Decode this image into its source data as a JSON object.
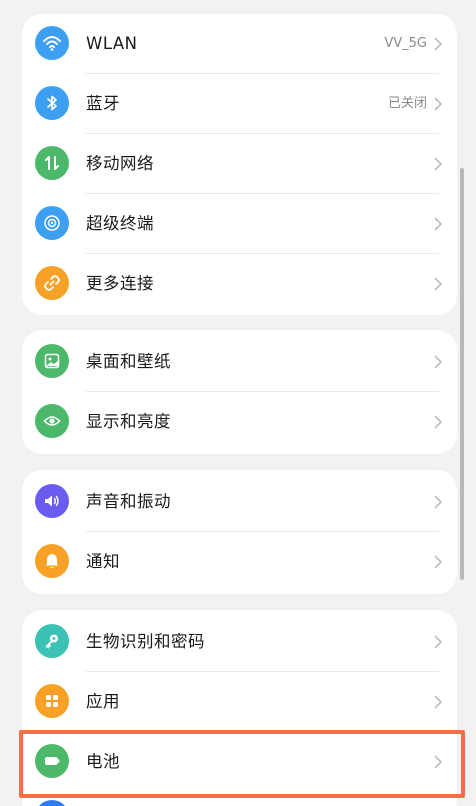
{
  "colors": {
    "wifi": "#3d9ff2",
    "bluetooth": "#3d9ff2",
    "mobile": "#4bb86a",
    "super_terminal": "#3d9ff2",
    "more_connect": "#f7a126",
    "desktop": "#4bb86a",
    "display": "#4bb86a",
    "sound": "#6b5cf0",
    "notification": "#f7a126",
    "biometric": "#3cc1b5",
    "apps": "#f7a126",
    "battery": "#4bb86a",
    "highlight": "#f46f45"
  },
  "groups": [
    {
      "items": [
        {
          "icon": "wifi-icon",
          "label": "WLAN",
          "value": "VV_5G"
        },
        {
          "icon": "bluetooth-icon",
          "label": "蓝牙",
          "value": "已关闭"
        },
        {
          "icon": "mobile-network-icon",
          "label": "移动网络",
          "value": ""
        },
        {
          "icon": "super-terminal-icon",
          "label": "超级终端",
          "value": ""
        },
        {
          "icon": "link-icon",
          "label": "更多连接",
          "value": ""
        }
      ]
    },
    {
      "items": [
        {
          "icon": "wallpaper-icon",
          "label": "桌面和壁纸",
          "value": ""
        },
        {
          "icon": "eye-icon",
          "label": "显示和亮度",
          "value": ""
        }
      ]
    },
    {
      "items": [
        {
          "icon": "speaker-icon",
          "label": "声音和振动",
          "value": ""
        },
        {
          "icon": "bell-icon",
          "label": "通知",
          "value": ""
        }
      ]
    },
    {
      "items": [
        {
          "icon": "key-icon",
          "label": "生物识别和密码",
          "value": ""
        },
        {
          "icon": "apps-grid-icon",
          "label": "应用",
          "value": ""
        },
        {
          "icon": "battery-icon",
          "label": "电池",
          "value": ""
        }
      ]
    }
  ]
}
